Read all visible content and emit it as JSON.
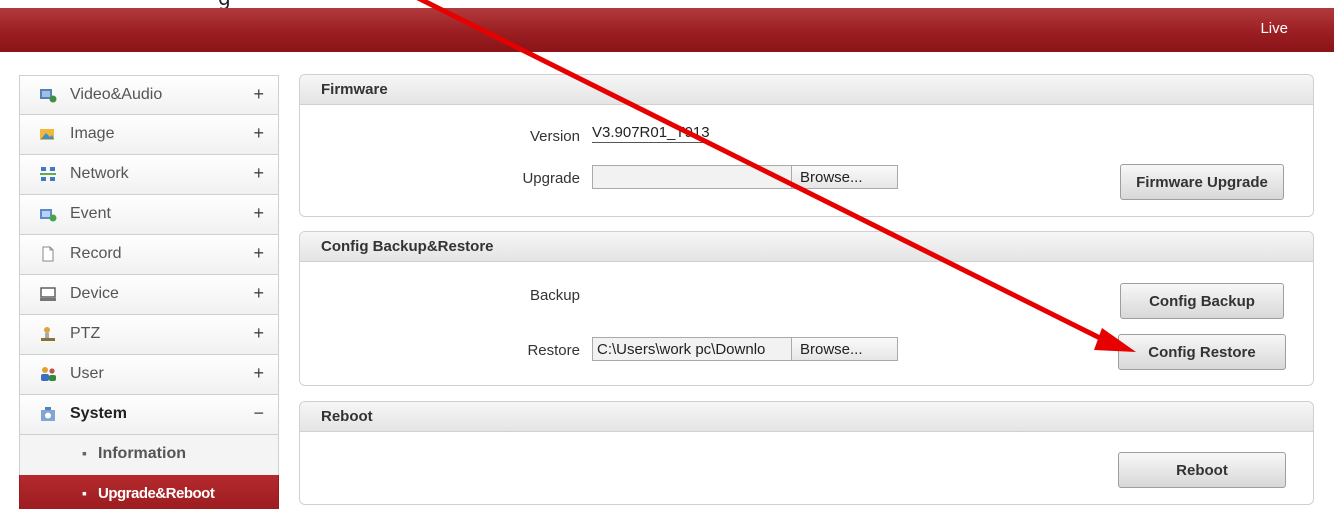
{
  "caption_fragment": "g",
  "header": {
    "live_label": "Live"
  },
  "sidebar": {
    "items": [
      {
        "label": "Video&Audio",
        "toggle": "+",
        "icon": "video-audio-icon"
      },
      {
        "label": "Image",
        "toggle": "+",
        "icon": "image-icon"
      },
      {
        "label": "Network",
        "toggle": "+",
        "icon": "network-icon"
      },
      {
        "label": "Event",
        "toggle": "+",
        "icon": "event-icon"
      },
      {
        "label": "Record",
        "toggle": "+",
        "icon": "record-icon"
      },
      {
        "label": "Device",
        "toggle": "+",
        "icon": "device-icon"
      },
      {
        "label": "PTZ",
        "toggle": "+",
        "icon": "ptz-icon"
      },
      {
        "label": "User",
        "toggle": "+",
        "icon": "user-icon"
      },
      {
        "label": "System",
        "toggle": "−",
        "icon": "system-icon"
      }
    ],
    "subitems": [
      {
        "label": "Information",
        "bullet": "▪"
      },
      {
        "label": "Upgrade&Reboot",
        "bullet": "▪"
      }
    ]
  },
  "firmware": {
    "title": "Firmware",
    "version_label": "Version",
    "version_value": "V3.907R01_T913",
    "upgrade_label": "Upgrade",
    "upgrade_path": "",
    "browse_label": "Browse...",
    "upgrade_button": "Firmware Upgrade"
  },
  "config": {
    "title": "Config Backup&Restore",
    "backup_label": "Backup",
    "backup_button": "Config Backup",
    "restore_label": "Restore",
    "restore_path": "C:\\Users\\work pc\\Downlo",
    "browse_label": "Browse...",
    "restore_button": "Config Restore"
  },
  "reboot": {
    "title": "Reboot",
    "reboot_button": "Reboot"
  },
  "colors": {
    "header_red": "#9a1e22",
    "annotation_arrow": "#e60000",
    "selected_menu": "#a82125"
  }
}
